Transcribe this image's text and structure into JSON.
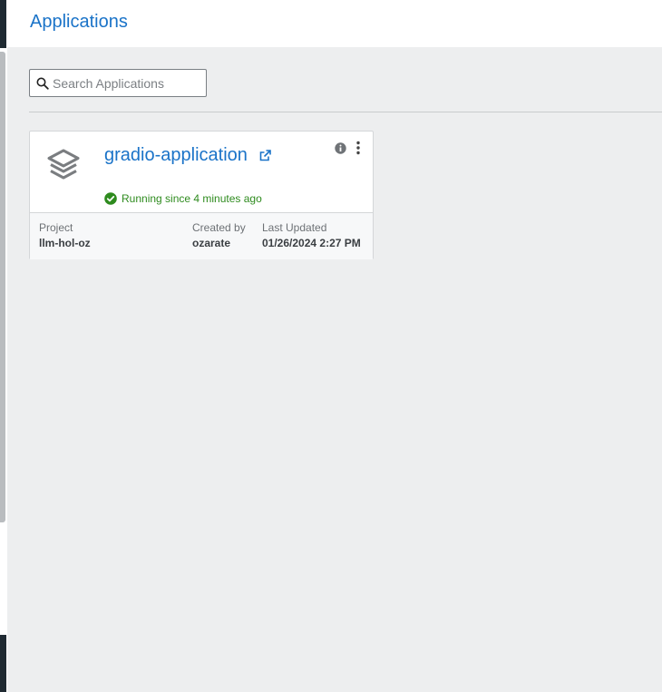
{
  "header": {
    "title": "Applications"
  },
  "search": {
    "placeholder": "Search Applications",
    "value": ""
  },
  "applications": [
    {
      "name": "gradio-application",
      "status": "Running since 4 minutes ago",
      "project_label": "Project",
      "project": "llm-hol-oz",
      "created_by_label": "Created by",
      "created_by": "ozarate",
      "last_updated_label": "Last Updated",
      "last_updated": "01/26/2024 2:27 PM",
      "icons": {
        "app": "layers-icon",
        "external": "external-link-icon",
        "info": "info-icon",
        "menu": "kebab-menu-icon",
        "status": "check-circle-icon"
      }
    }
  ],
  "colors": {
    "accent": "#1a73c8",
    "status_running": "#2e8b1e",
    "background": "#edeeef"
  }
}
